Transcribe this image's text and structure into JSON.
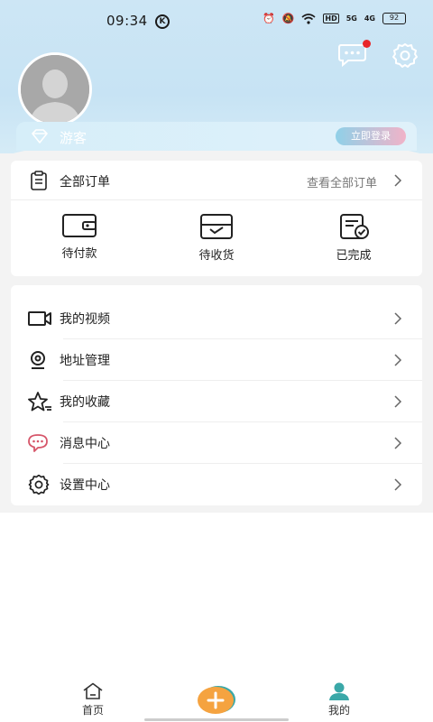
{
  "status_bar": {
    "time": "09:34",
    "k_badge": "K",
    "hd": "HD",
    "net1": "5G",
    "net2": "4G",
    "battery": "92"
  },
  "profile": {
    "username": "游客",
    "login_label": "立即登录"
  },
  "orders": {
    "title": "全部订单",
    "view_all": "查看全部订单",
    "items": [
      {
        "label": "待付款",
        "icon": "wallet-icon"
      },
      {
        "label": "待收货",
        "icon": "inbox-icon"
      },
      {
        "label": "已完成",
        "icon": "completed-doc-icon"
      }
    ]
  },
  "menu": {
    "items": [
      {
        "label": "我的视频",
        "icon": "video-camera-icon"
      },
      {
        "label": "地址管理",
        "icon": "location-pin-icon"
      },
      {
        "label": "我的收藏",
        "icon": "star-icon"
      },
      {
        "label": "消息中心",
        "icon": "chat-bubble-icon"
      },
      {
        "label": "设置中心",
        "icon": "gear-icon"
      }
    ]
  },
  "tabbar": {
    "home": "首页",
    "mine": "我的"
  },
  "colors": {
    "header_bg": "#c7e3f4",
    "accent_orange": "#f5a340",
    "accent_teal": "#3aa8a8",
    "badge_red": "#e8262a"
  }
}
